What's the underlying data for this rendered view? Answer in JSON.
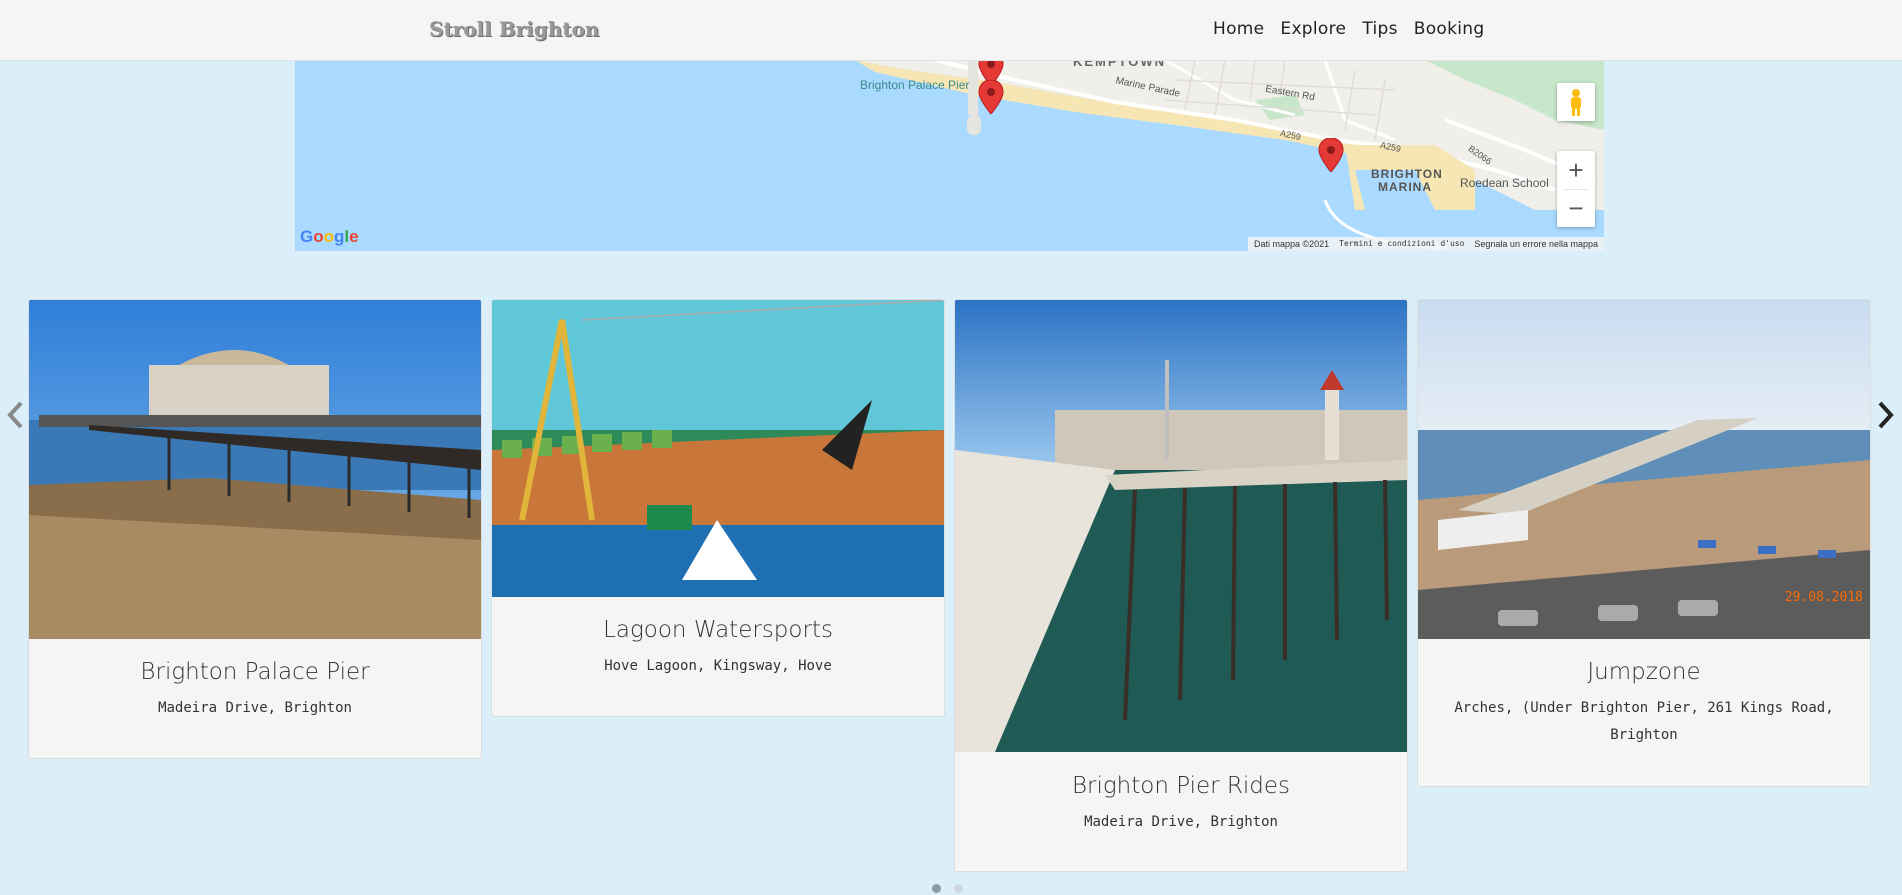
{
  "navbar": {
    "brand": "Stroll Brighton",
    "links": [
      "Home",
      "Explore",
      "Tips",
      "Booking"
    ]
  },
  "map": {
    "labels": {
      "kemptown": "KEMPTOWN",
      "palace_pier": "Brighton Palace Pier",
      "marine_parade": "Marine Parade",
      "eastern_rd": "Eastern Rd",
      "a259_1": "A259",
      "a259_2": "A259",
      "b2066": "B2066",
      "marina_line1": "BRIGHTON",
      "marina_line2": "MARINA",
      "roedean": "Roedean School"
    },
    "footer": {
      "data": "Dati mappa ©2021",
      "terms": "Termini e condizioni d'uso",
      "report": "Segnala un errore nella mappa"
    },
    "google_logo": "Google",
    "zoom_in": "+",
    "zoom_out": "−"
  },
  "cards": [
    {
      "title": "Brighton Palace Pier",
      "address": "Madeira Drive, Brighton"
    },
    {
      "title": "Lagoon Watersports",
      "address": "Hove Lagoon, Kingsway, Hove"
    },
    {
      "title": "Brighton Pier Rides",
      "address": "Madeira Drive, Brighton"
    },
    {
      "title": "Jumpzone",
      "address": "Arches, (Under Brighton Pier, 261 Kings Road, Brighton"
    }
  ],
  "jumpzone_photo_date": "29.08.2018",
  "carousel": {
    "pages": 2,
    "active": 1
  },
  "colors": {
    "page_bg": "#dbeffb",
    "sea": "#aadaff",
    "marker": "#e53935",
    "card_bg": "#f5f5f5"
  },
  "icons": {
    "prev": "chevron-left-icon",
    "next": "chevron-right-icon",
    "pegman": "street-view-pegman-icon",
    "marker": "map-marker-icon"
  }
}
